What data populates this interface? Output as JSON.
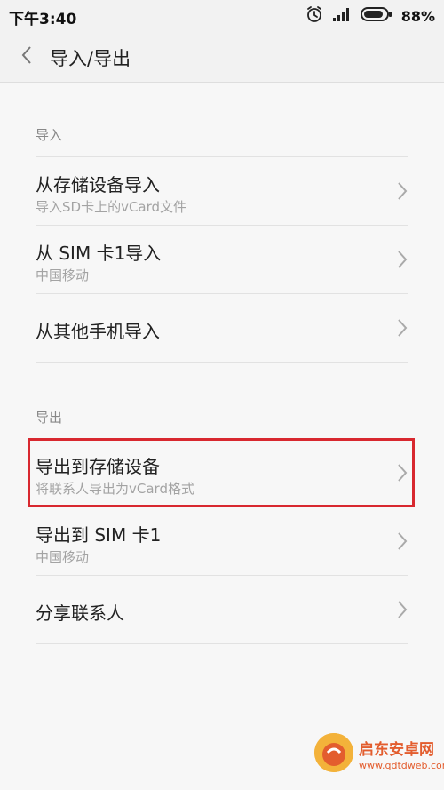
{
  "status_bar": {
    "time": "下午3:40",
    "battery_percent": "88%",
    "battery_level": 0.88,
    "icons": [
      "alarm-icon",
      "signal-icon",
      "battery-icon"
    ]
  },
  "header": {
    "title": "导入/导出",
    "back_icon": "chevron-left-icon"
  },
  "import_section": {
    "header": "导入",
    "items": [
      {
        "title": "从存储设备导入",
        "subtitle": "导入SD卡上的vCard文件"
      },
      {
        "title": "从 SIM 卡1导入",
        "subtitle": "中国移动"
      },
      {
        "title": "从其他手机导入",
        "subtitle": ""
      }
    ]
  },
  "export_section": {
    "header": "导出",
    "items": [
      {
        "title": "导出到存储设备",
        "subtitle": "将联系人导出为vCard格式"
      },
      {
        "title": "导出到 SIM 卡1",
        "subtitle": "中国移动"
      },
      {
        "title": "分享联系人",
        "subtitle": ""
      }
    ]
  },
  "watermark": {
    "name": "启东安卓网",
    "url": "www.qdtdweb.com"
  },
  "colors": {
    "highlight": "#d8282f",
    "background": "#f7f7f7",
    "watermark": "#e35d2e"
  }
}
